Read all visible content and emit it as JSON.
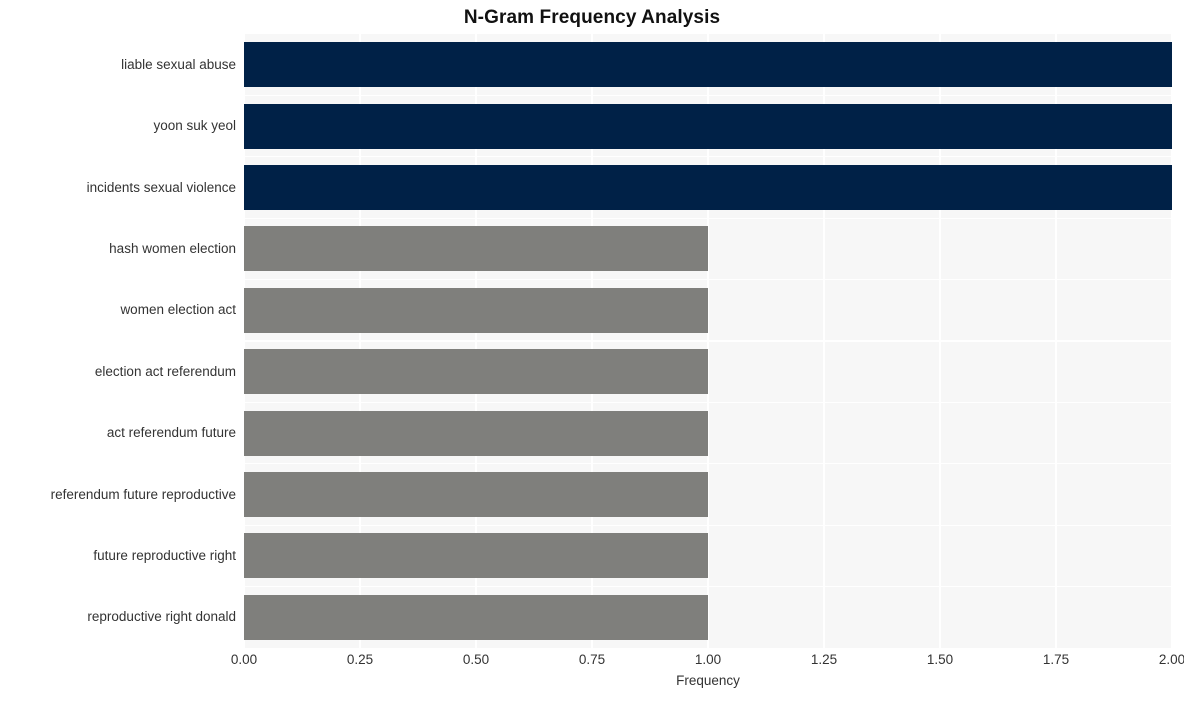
{
  "chart_data": {
    "type": "bar",
    "orientation": "horizontal",
    "title": "N-Gram Frequency Analysis",
    "xlabel": "Frequency",
    "ylabel": "",
    "xlim": [
      0.0,
      2.0
    ],
    "xticks": [
      "0.00",
      "0.25",
      "0.50",
      "0.75",
      "1.00",
      "1.25",
      "1.50",
      "1.75",
      "2.00"
    ],
    "xtick_values": [
      0.0,
      0.25,
      0.5,
      0.75,
      1.0,
      1.25,
      1.5,
      1.75,
      2.0
    ],
    "grid": true,
    "legend": "none",
    "categories": [
      "liable sexual abuse",
      "yoon suk yeol",
      "incidents sexual violence",
      "hash women election",
      "women election act",
      "election act referendum",
      "act referendum future",
      "referendum future reproductive",
      "future reproductive right",
      "reproductive right donald"
    ],
    "values": [
      2,
      2,
      2,
      1,
      1,
      1,
      1,
      1,
      1,
      1
    ],
    "bar_colors": [
      "#002147",
      "#002147",
      "#002147",
      "#7f7f7c",
      "#7f7f7c",
      "#7f7f7c",
      "#7f7f7c",
      "#7f7f7c",
      "#7f7f7c",
      "#7f7f7c"
    ],
    "palette": {
      "high": "#002147",
      "low": "#7f7f7c",
      "plot_background": "#f7f7f7",
      "grid": "#ffffff",
      "text": "#333333",
      "title": "#111111"
    }
  }
}
